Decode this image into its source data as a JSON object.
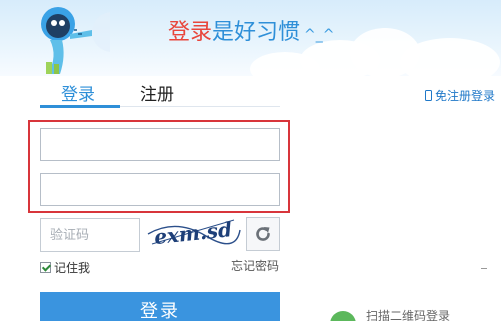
{
  "banner": {
    "slogan_red": "登录",
    "slogan_blue": "是好习惯",
    "slogan_emoticon": "^_^",
    "mascot_icon": "penguin-mascot-icon"
  },
  "tabs": [
    {
      "label": "登录",
      "active": true
    },
    {
      "label": "注册",
      "active": false
    }
  ],
  "no_register_link": "免注册登录",
  "form": {
    "account": {
      "value": "",
      "placeholder": ""
    },
    "password": {
      "value": "",
      "placeholder": ""
    },
    "captcha": {
      "placeholder": "验证码",
      "image_text": "exm.sd"
    },
    "refresh_icon": "refresh-icon",
    "remember_label": "记住我",
    "remember_checked": true,
    "forgot_label": "忘记密码",
    "submit_label": "登录"
  },
  "qr_login": {
    "label": "扫描二维码登录"
  },
  "colors": {
    "accent": "#3a94df",
    "highlight": "#d8353b",
    "slogan_red": "#e8463c"
  }
}
